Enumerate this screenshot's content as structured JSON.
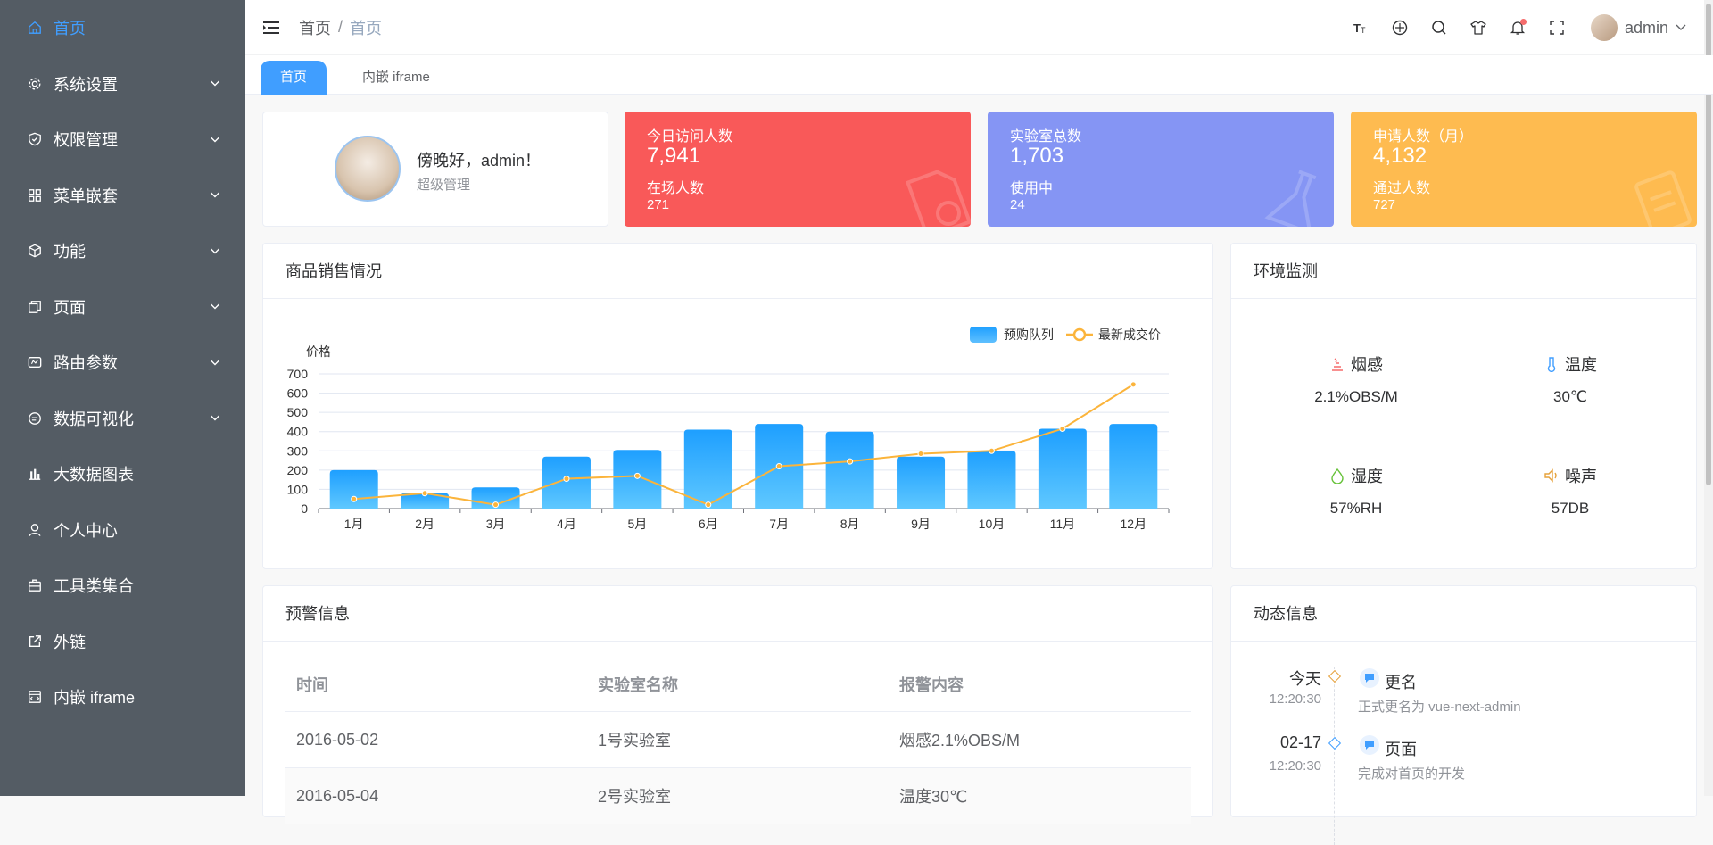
{
  "sidebar": {
    "items": [
      {
        "label": "首页",
        "icon": "home-icon",
        "active": true,
        "expandable": false
      },
      {
        "label": "系统设置",
        "icon": "gear-icon",
        "expandable": true
      },
      {
        "label": "权限管理",
        "icon": "shield-icon",
        "expandable": true
      },
      {
        "label": "菜单嵌套",
        "icon": "grid-icon",
        "expandable": true
      },
      {
        "label": "功能",
        "icon": "cube-icon",
        "expandable": true
      },
      {
        "label": "页面",
        "icon": "copy-icon",
        "expandable": true
      },
      {
        "label": "路由参数",
        "icon": "route-icon",
        "expandable": true
      },
      {
        "label": "数据可视化",
        "icon": "chat-icon",
        "expandable": true
      },
      {
        "label": "大数据图表",
        "icon": "bar-chart-icon",
        "expandable": false
      },
      {
        "label": "个人中心",
        "icon": "user-icon",
        "expandable": false
      },
      {
        "label": "工具类集合",
        "icon": "briefcase-icon",
        "expandable": false
      },
      {
        "label": "外链",
        "icon": "external-link-icon",
        "expandable": false
      },
      {
        "label": "内嵌 iframe",
        "icon": "iframe-icon",
        "expandable": false
      }
    ],
    "active_color": "#409eff",
    "bg_color": "#545c64"
  },
  "header": {
    "breadcrumb": [
      "首页",
      "首页"
    ],
    "breadcrumb_sep": "/",
    "user": "admin",
    "tools": [
      "font-size-icon",
      "globe-icon",
      "search-icon",
      "shirt-icon",
      "bell-icon",
      "fullscreen-icon"
    ]
  },
  "tags": [
    "首页",
    "内嵌 iframe"
  ],
  "welcome": {
    "greeting": "傍晚好，admin！",
    "role": "超级管理"
  },
  "stats": [
    {
      "title": "今日访问人数",
      "value": "7,941",
      "sub_title": "在场人数",
      "sub_value": "271",
      "color": "#f95959",
      "icon": "document-icon"
    },
    {
      "title": "实验室总数",
      "value": "1,703",
      "sub_title": "使用中",
      "sub_value": "24",
      "color": "#8595f4",
      "icon": "flask-icon"
    },
    {
      "title": "申请人数（月）",
      "value": "4,132",
      "sub_title": "通过人数",
      "sub_value": "727",
      "color": "#febb50",
      "icon": "clipboard-icon"
    }
  ],
  "sales": {
    "title": "商品销售情况"
  },
  "chart_data": {
    "type": "bar",
    "categories": [
      "1月",
      "2月",
      "3月",
      "4月",
      "5月",
      "6月",
      "7月",
      "8月",
      "9月",
      "10月",
      "11月",
      "12月"
    ],
    "series": [
      {
        "name": "预购队列",
        "type": "bar",
        "values": [
          200,
          80,
          110,
          270,
          305,
          410,
          440,
          400,
          270,
          300,
          415,
          440
        ]
      },
      {
        "name": "最新成交价",
        "type": "line",
        "values": [
          50,
          80,
          20,
          155,
          170,
          20,
          220,
          245,
          285,
          300,
          415,
          645
        ]
      }
    ],
    "ylabel": "价格",
    "yticks": [
      0,
      100,
      200,
      300,
      400,
      500,
      600,
      700
    ],
    "ylim": [
      0,
      700
    ],
    "legend_position": "top-right",
    "bar_color": "#1e9fff",
    "line_color": "#fbb43b"
  },
  "env": {
    "title": "环境监测",
    "items": [
      {
        "name": "烟感",
        "value": "2.1%OBS/M",
        "icon": "smoke-icon",
        "color": "#f56c6c"
      },
      {
        "name": "温度",
        "value": "30℃",
        "icon": "temperature-icon",
        "color": "#409eff"
      },
      {
        "name": "湿度",
        "value": "57%RH",
        "icon": "humidity-icon",
        "color": "#67c23a"
      },
      {
        "name": "噪声",
        "value": "57DB",
        "icon": "speaker-icon",
        "color": "#e6a23c"
      }
    ]
  },
  "warn": {
    "title": "预警信息",
    "columns": [
      "时间",
      "实验室名称",
      "报警内容"
    ],
    "rows": [
      [
        "2016-05-02",
        "1号实验室",
        "烟感2.1%OBS/M"
      ],
      [
        "2016-05-04",
        "2号实验室",
        "温度30℃"
      ]
    ]
  },
  "dyn": {
    "title": "动态信息",
    "items": [
      {
        "time1": "今天",
        "time2": "12:20:30",
        "title": "更名",
        "desc": "正式更名为 vue-next-admin",
        "color": "#e6a23c"
      },
      {
        "time1": "02-17",
        "time2": "12:20:30",
        "title": "页面",
        "desc": "完成对首页的开发",
        "color": "#409eff"
      }
    ]
  }
}
